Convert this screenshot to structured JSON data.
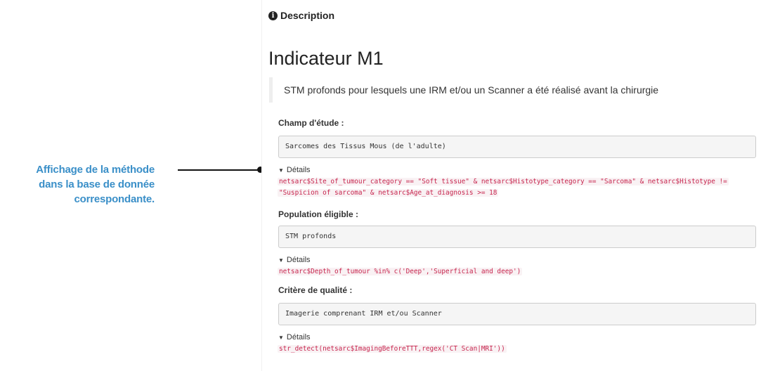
{
  "annotation": {
    "lines": [
      "Affichage de la méthode",
      "dans la base de donnée",
      "correspondante."
    ]
  },
  "panel": {
    "description_label": "Description",
    "title": "Indicateur M1",
    "blockquote": "STM profonds pour lesquels une IRM et/ou un Scanner a été réalisé avant la chirurgie",
    "sections": [
      {
        "label": "Champ d'étude :",
        "value": "Sarcomes des Tissus Mous (de l'adulte)",
        "details_label": "Détails",
        "code": "netsarc$Site_of_tumour_category == \"Soft tissue\" & netsarc$Histotype_category == \"Sarcoma\" & netsarc$Histotype != \"Suspicion of sarcoma\" & netsarc$Age_at_diagnosis >= 18"
      },
      {
        "label": "Population éligible :",
        "value": "STM profonds",
        "details_label": "Détails",
        "code": "netsarc$Depth_of_tumour %in% c('Deep','Superficial and deep')"
      },
      {
        "label": "Critère de qualité :",
        "value": "Imagerie comprenant IRM et/ou Scanner",
        "details_label": "Détails",
        "code": "str_detect(netsarc$ImagingBeforeTTT,regex('CT Scan|MRI'))"
      }
    ]
  },
  "colors": {
    "annotation": "#3a8fc8",
    "code": "#c7254e",
    "code_bg": "#f9f2f4"
  }
}
